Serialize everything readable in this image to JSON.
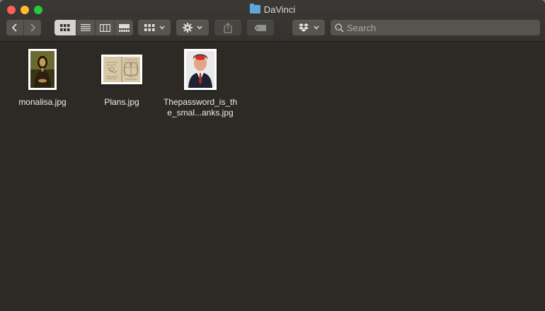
{
  "window": {
    "title": "DaVinci"
  },
  "toolbar": {
    "back_icon": "chevron-left-icon",
    "forward_icon": "chevron-right-icon",
    "view_modes": [
      "icon-view",
      "list-view",
      "column-view",
      "gallery-view"
    ],
    "active_view": "icon-view",
    "group_icon": "grid-group-icon",
    "action_icon": "gear-icon",
    "share_icon": "share-icon",
    "tag_icon": "tag-icon",
    "dropbox_icon": "dropbox-icon"
  },
  "search": {
    "placeholder": "Search"
  },
  "files": [
    {
      "name": "monalisa.jpg",
      "icon": "portrait-thumbnail"
    },
    {
      "name": "Plans.jpg",
      "icon": "sketch-thumbnail"
    },
    {
      "name": "Thepassword_is_the_smal...anks.jpg",
      "icon": "photo-thumbnail"
    }
  ],
  "colors": {
    "window_bg": "#2d2a25",
    "toolbar_bg": "#3a3935",
    "folder_blue": "#5fa6da"
  }
}
